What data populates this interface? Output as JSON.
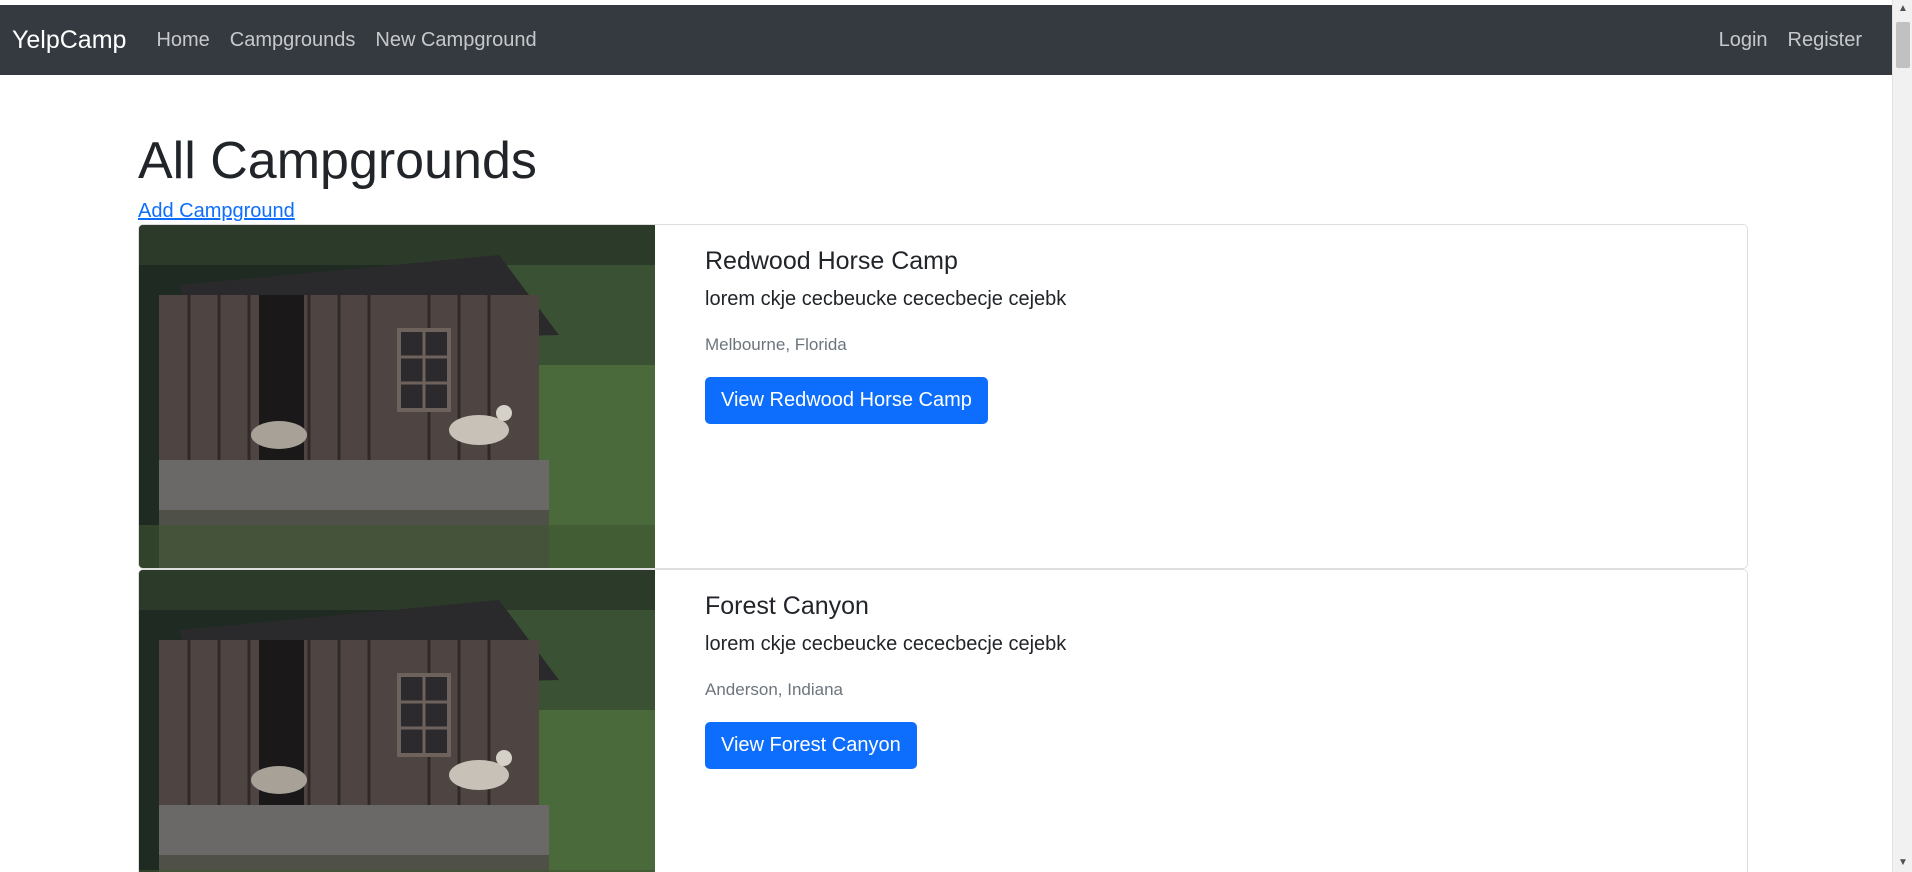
{
  "navbar": {
    "brand": "YelpCamp",
    "links": [
      {
        "label": "Home"
      },
      {
        "label": "Campgrounds"
      },
      {
        "label": "New Campground"
      }
    ],
    "auth": [
      {
        "label": "Login"
      },
      {
        "label": "Register"
      }
    ]
  },
  "main": {
    "title": "All Campgrounds",
    "add_link": "Add Campground",
    "campgrounds": [
      {
        "title": "Redwood Horse Camp",
        "description": "lorem ckje cecbeucke cececbecje cejebk",
        "location": "Melbourne, Florida",
        "button": "View Redwood Horse Camp"
      },
      {
        "title": "Forest Canyon",
        "description": "lorem ckje cecbeucke cececbecje cejebk",
        "location": "Anderson, Indiana",
        "button": "View Forest Canyon"
      }
    ]
  },
  "colors": {
    "navbar_bg": "#343a40",
    "primary": "#0d6efd",
    "muted": "#6c757d"
  }
}
